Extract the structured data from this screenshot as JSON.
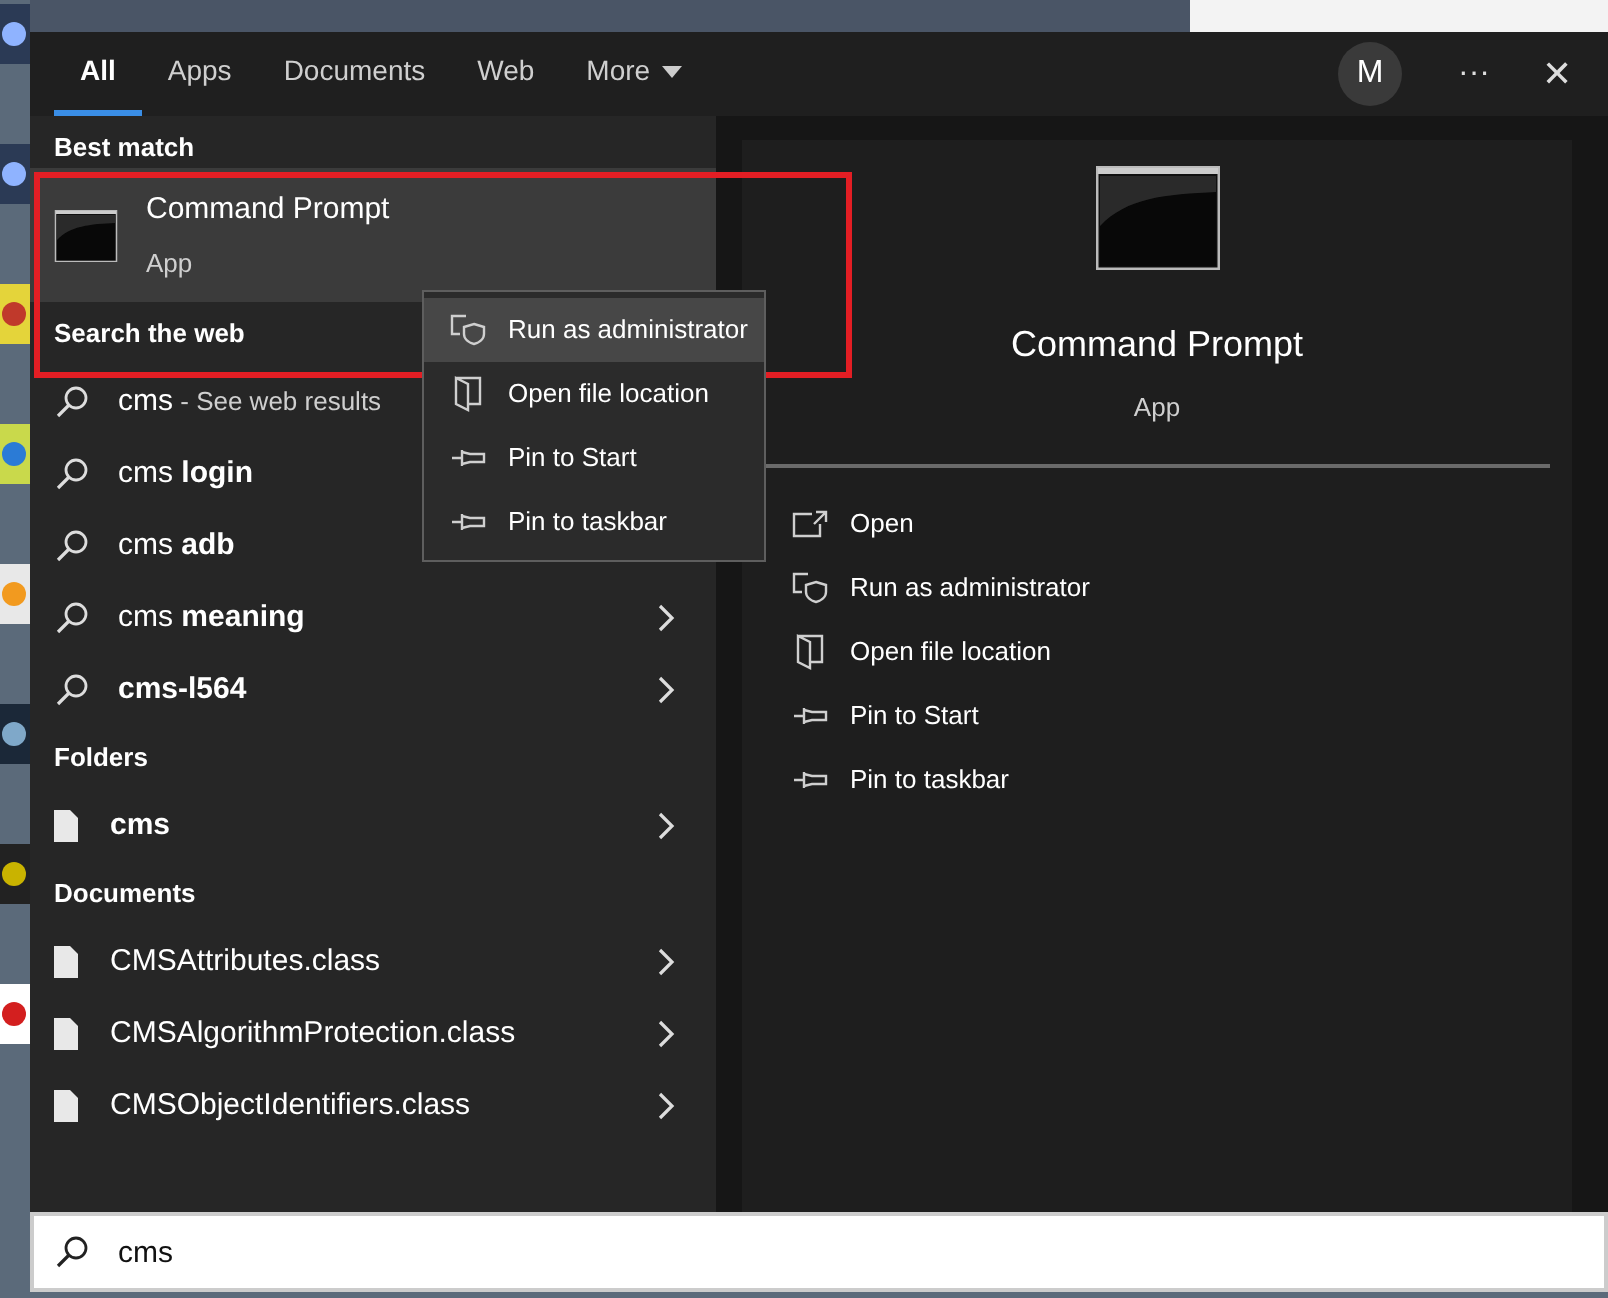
{
  "tabs": [
    {
      "label": "All",
      "selected": true
    },
    {
      "label": "Apps",
      "selected": false
    },
    {
      "label": "Documents",
      "selected": false
    },
    {
      "label": "Web",
      "selected": false
    },
    {
      "label": "More",
      "selected": false
    }
  ],
  "account": {
    "initial": "M"
  },
  "more_options": "···",
  "close": "✕",
  "best_match": {
    "heading": "Best match",
    "title": "Command Prompt",
    "subtitle": "App"
  },
  "search_web": {
    "heading": "Search the web",
    "items": [
      {
        "query": "cms",
        "suffix": "- See web results"
      },
      {
        "query": "cms **login**"
      },
      {
        "query": "cms **adb**"
      },
      {
        "query": "cms **meaning**",
        "expandable": true
      },
      {
        "query": "**cms-l564**",
        "expandable": true
      }
    ]
  },
  "folders": {
    "heading": "Folders",
    "items": [
      {
        "name": "cms",
        "expandable": true
      }
    ]
  },
  "documents": {
    "heading": "Documents",
    "items": [
      {
        "name": "CMSAttributes.class",
        "expandable": true
      },
      {
        "name": "CMSAlgorithmProtection.class",
        "expandable": true
      },
      {
        "name": "CMSObjectIdentifiers.class",
        "expandable": true
      }
    ]
  },
  "context_menu": {
    "items": [
      {
        "kind": "admin",
        "label": "Run as administrator",
        "selected": true
      },
      {
        "kind": "location",
        "label": "Open file location",
        "selected": false
      },
      {
        "kind": "pin",
        "label": "Pin to Start",
        "selected": false
      },
      {
        "kind": "pin",
        "label": "Pin to taskbar",
        "selected": false
      }
    ]
  },
  "preview": {
    "title": "Command Prompt",
    "subtitle": "App",
    "actions": [
      {
        "kind": "open",
        "label": "Open"
      },
      {
        "kind": "admin",
        "label": "Run as administrator"
      },
      {
        "kind": "location",
        "label": "Open file location"
      },
      {
        "kind": "pin",
        "label": "Pin to Start"
      },
      {
        "kind": "pin",
        "label": "Pin to taskbar"
      }
    ]
  },
  "search_box": {
    "value": "cms"
  }
}
